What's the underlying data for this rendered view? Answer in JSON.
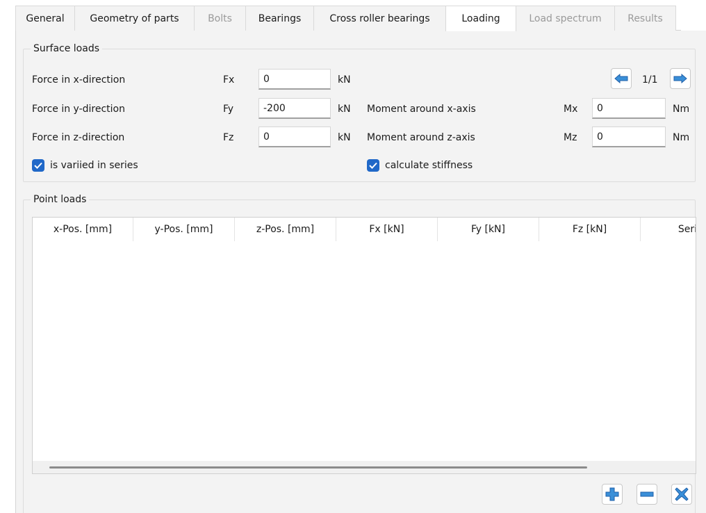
{
  "tabs": [
    {
      "label": "General",
      "state": "normal"
    },
    {
      "label": "Geometry of parts",
      "state": "normal"
    },
    {
      "label": "Bolts",
      "state": "disabled"
    },
    {
      "label": "Bearings",
      "state": "normal"
    },
    {
      "label": "Cross roller bearings",
      "state": "normal"
    },
    {
      "label": "Loading",
      "state": "active"
    },
    {
      "label": "Load spectrum",
      "state": "disabled"
    },
    {
      "label": "Results",
      "state": "disabled"
    }
  ],
  "surface_loads": {
    "title": "Surface loads",
    "fx": {
      "label": "Force in x-direction",
      "symbol": "Fx",
      "value": "0",
      "unit": "kN"
    },
    "fy": {
      "label": "Force in y-direction",
      "symbol": "Fy",
      "value": "-200",
      "unit": "kN"
    },
    "fz": {
      "label": "Force in z-direction",
      "symbol": "Fz",
      "value": "0",
      "unit": "kN"
    },
    "mx": {
      "label": "Moment around x-axis",
      "symbol": "Mx",
      "value": "0",
      "unit": "Nm"
    },
    "mz": {
      "label": "Moment around z-axis",
      "symbol": "Mz",
      "value": "0",
      "unit": "Nm"
    },
    "varied_in_series": {
      "label": "is variied in series",
      "checked": true
    },
    "calc_stiffness": {
      "label": "calculate stiffness",
      "checked": true
    },
    "pager": "1/1"
  },
  "point_loads": {
    "title": "Point loads",
    "columns": [
      "x-Pos. [mm]",
      "y-Pos. [mm]",
      "z-Pos. [mm]",
      "Fx [kN]",
      "Fy [kN]",
      "Fz [kN]",
      "Seri"
    ],
    "rows": []
  },
  "colors": {
    "accent": "#2068c8",
    "icon_blue": "#3a8fd8",
    "panel_bg": "#f3f3f3"
  },
  "icons": [
    "arrow-left-icon",
    "arrow-right-icon",
    "add-icon",
    "remove-icon",
    "delete-icon",
    "checkmark-icon"
  ]
}
